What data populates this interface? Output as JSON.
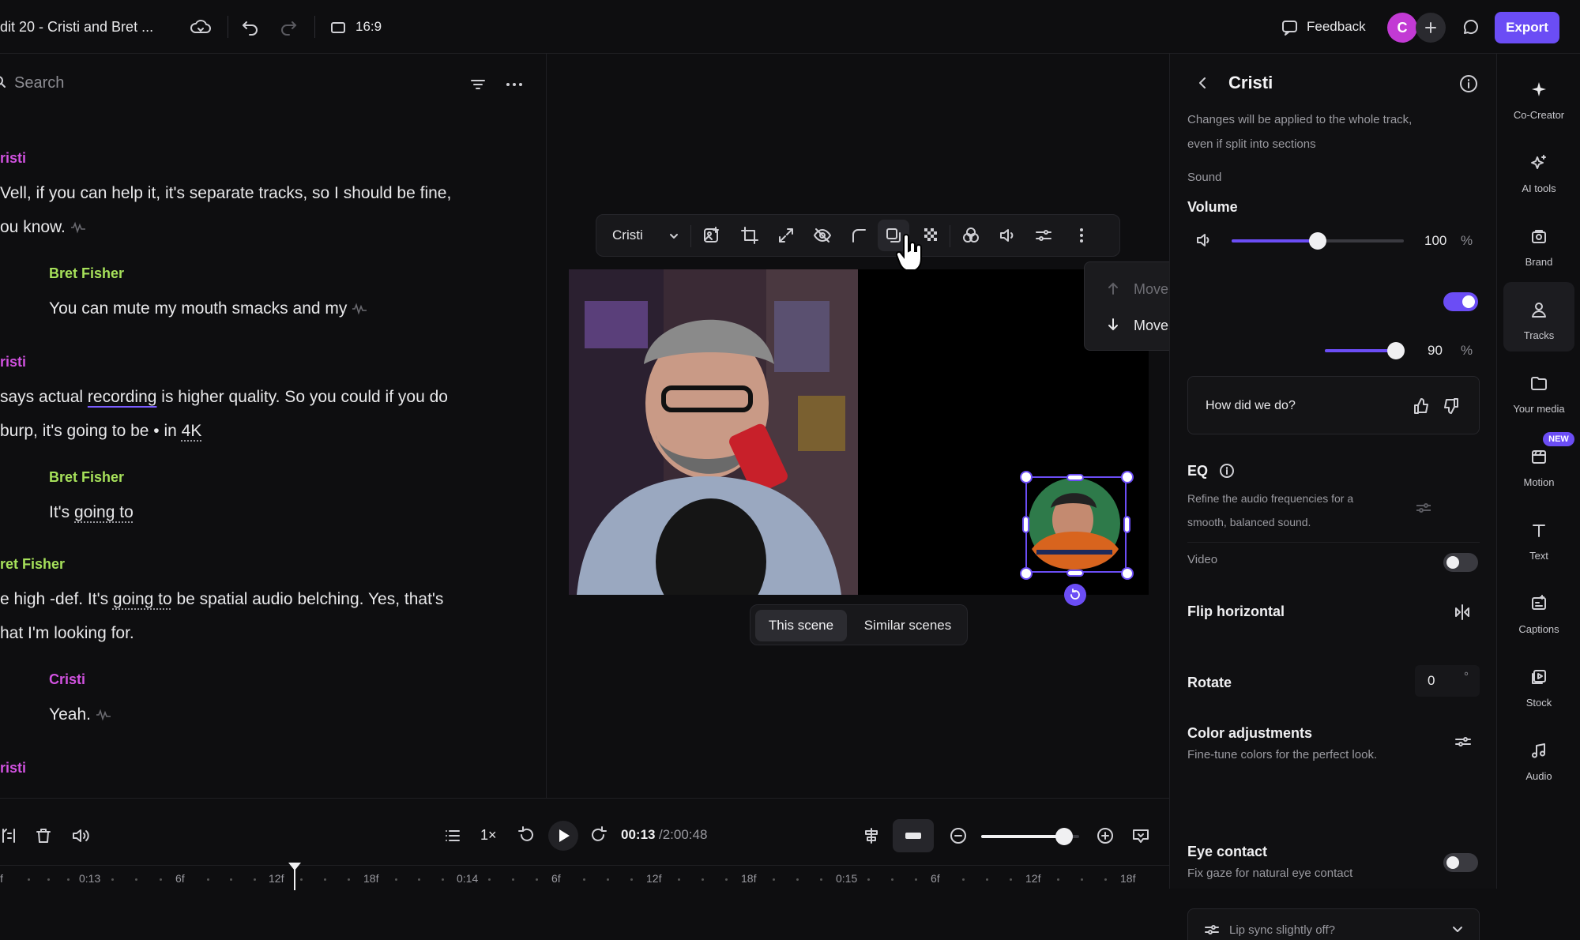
{
  "topbar": {
    "project_title": "dit 20 - Cristi and Bret ...",
    "aspect_ratio": "16:9",
    "feedback_label": "Feedback",
    "avatar_letter": "C",
    "export_label": "Export"
  },
  "left": {
    "search_placeholder": "Search",
    "blocks": [
      {
        "speaker": "risti",
        "lines": [
          "Vell, if you can help it, it's separate tracks, so I should be fine,",
          "ou know."
        ]
      },
      {
        "speaker": "Bret Fisher",
        "lines": [
          "You can mute my mouth smacks and my"
        ]
      },
      {
        "speaker": "risti",
        "lines_parts": [
          [
            "says actual ",
            "recording",
            " is higher  quality. So you could if you do"
          ],
          [
            "burp, it's going to be • in ",
            "4K",
            ""
          ]
        ]
      },
      {
        "speaker": "Bret Fisher",
        "lines_parts": [
          [
            "It's ",
            "going to",
            ""
          ]
        ]
      },
      {
        "speaker": "ret Fisher",
        "lines_parts": [
          [
            "e high -def. It's ",
            "going to",
            " be spatial audio belching. Yes, that's"
          ],
          [
            "hat I'm looking for.",
            "",
            ""
          ]
        ]
      },
      {
        "speaker": "Cristi",
        "lines": [
          "Yeah."
        ]
      },
      {
        "speaker": "risti",
        "lines": []
      }
    ]
  },
  "toolbar": {
    "track_name": "Cristi"
  },
  "menu": {
    "move_forward": "Move Forward",
    "move_backwards": "Move Backwards"
  },
  "scenes": {
    "this_scene": "This scene",
    "similar_scenes": "Similar scenes"
  },
  "playback": {
    "speed": "1×",
    "current_time": "00:13",
    "total_time": "/2:00:48",
    "zoom_fraction": 0.85
  },
  "timeline": {
    "ticks": [
      "f",
      "0:13",
      "6f",
      "12f",
      "18f",
      "0:14",
      "6f",
      "12f",
      "18f",
      "0:15",
      "6f",
      "12f",
      "18f"
    ]
  },
  "panel": {
    "title": "Cristi",
    "note_line1": "Changes will be applied to the whole track,",
    "note_line2": "even if split into sections",
    "sound_label": "Sound",
    "volume_label": "Volume",
    "volume_value": "100",
    "volume_fraction": 0.5,
    "percent": "%",
    "second_value": "90",
    "second_fraction": 0.9,
    "feedback_question": "How did we do?",
    "eq_label": "EQ",
    "eq_desc1": "Refine the audio frequencies for a",
    "eq_desc2": "smooth, balanced sound.",
    "video_label": "Video",
    "flip_label": "Flip horizontal",
    "rotate_label": "Rotate",
    "rotate_value": "0",
    "degree": "°",
    "color_label": "Color adjustments",
    "color_desc": "Fine-tune colors for the perfect look.",
    "eye_label": "Eye contact",
    "eye_desc": "Fix gaze for natural eye contact",
    "lipsync_label": "Lip sync slightly off?"
  },
  "nav": [
    {
      "label": "Co-Creator",
      "icon": "sparkle-icon"
    },
    {
      "label": "AI tools",
      "icon": "ai-sparkle-icon"
    },
    {
      "label": "Brand",
      "icon": "brand-icon"
    },
    {
      "label": "Tracks",
      "icon": "person-icon"
    },
    {
      "label": "Your media",
      "icon": "folder-icon"
    },
    {
      "label": "Motion",
      "icon": "motion-icon",
      "badge": "NEW"
    },
    {
      "label": "Text",
      "icon": "text-icon"
    },
    {
      "label": "Captions",
      "icon": "captions-icon"
    },
    {
      "label": "Stock",
      "icon": "stock-icon"
    },
    {
      "label": "Audio",
      "icon": "music-note-icon"
    }
  ],
  "colors": {
    "accent": "#6b4df5",
    "speaker_pink": "#d152e0",
    "speaker_green": "#a6e05a"
  }
}
